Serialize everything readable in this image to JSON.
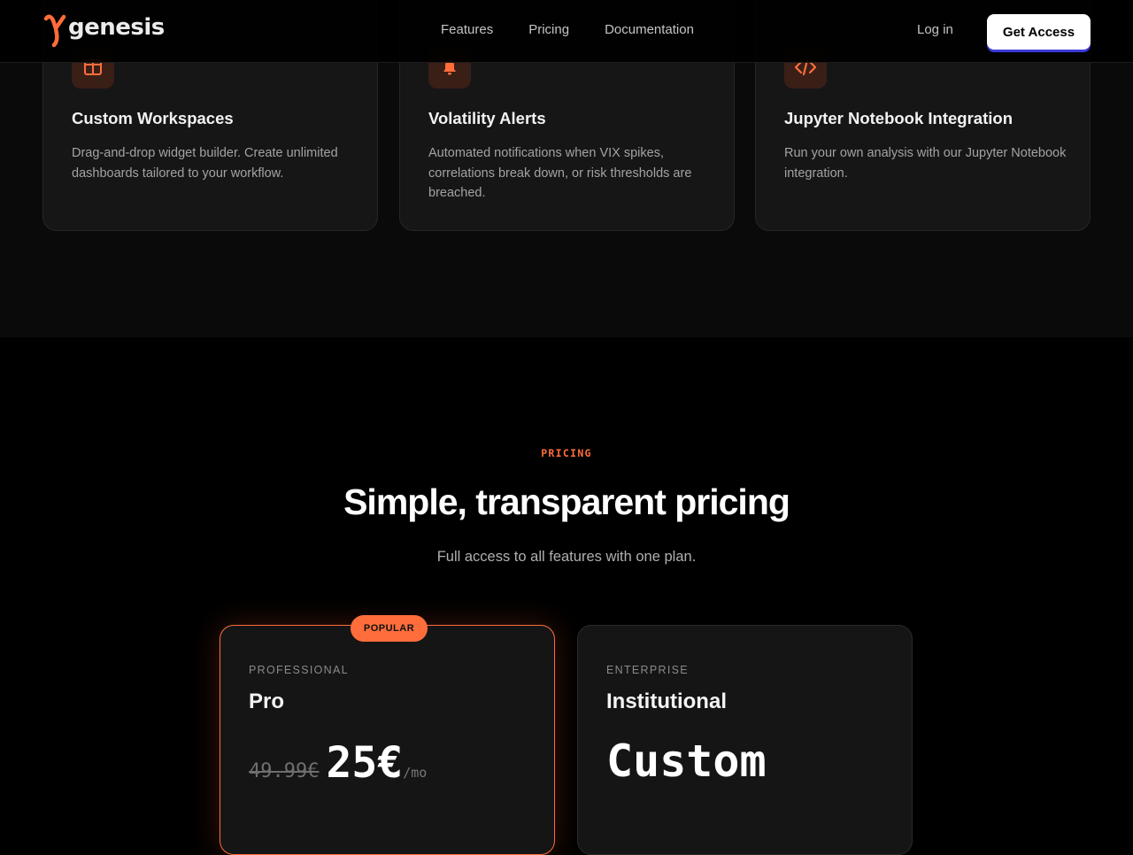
{
  "nav": {
    "brand": "genesis",
    "links": [
      "Features",
      "Pricing",
      "Documentation"
    ],
    "login": "Log in",
    "cta": "Get Access"
  },
  "features": [
    {
      "icon": "columns-layout-icon",
      "title": "Custom Workspaces",
      "description": "Drag-and-drop widget builder. Create unlimited dashboards tailored to your workflow."
    },
    {
      "icon": "bell-icon",
      "title": "Volatility Alerts",
      "description": "Automated notifications when VIX spikes, correlations break down, or risk thresholds are breached."
    },
    {
      "icon": "code-icon",
      "title": "Jupyter Notebook Integration",
      "description": "Run your own analysis with our Jupyter Notebook integration."
    }
  ],
  "pricing": {
    "eyebrow": "PRICING",
    "heading": "Simple, transparent pricing",
    "subheading": "Full access to all features with one plan.",
    "plans": [
      {
        "badge": "POPULAR",
        "tier": "PROFESSIONAL",
        "name": "Pro",
        "old_price": "49.99€",
        "price": "25€",
        "period": "/mo"
      },
      {
        "tier": "ENTERPRISE",
        "name": "Institutional",
        "price": "Custom"
      }
    ]
  },
  "colors": {
    "accent": "#ff6d3b",
    "background": "#000000",
    "card": "#161617"
  }
}
